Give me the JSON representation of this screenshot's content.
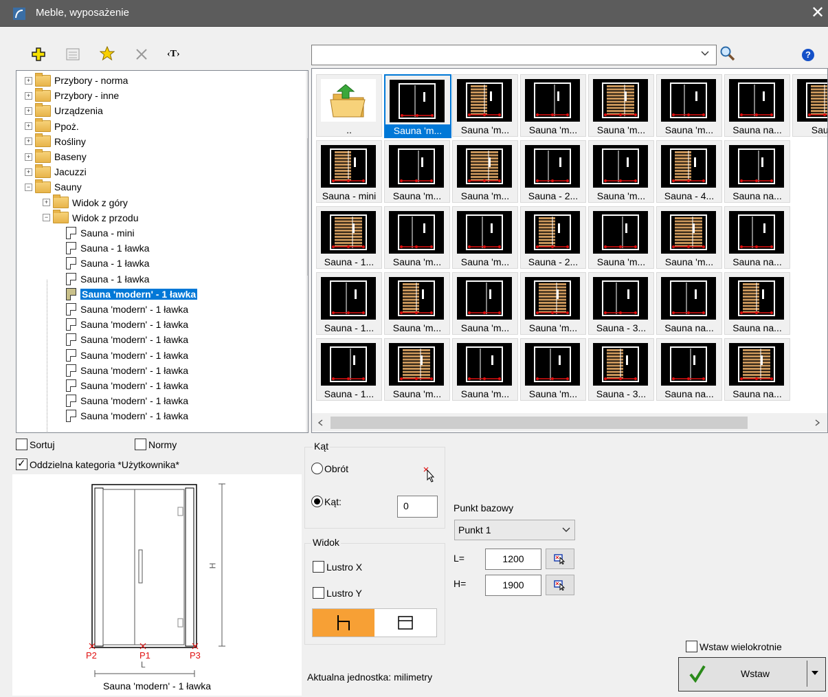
{
  "window": {
    "title": "Meble, wyposażenie",
    "close": "✕"
  },
  "toolbar": {
    "text_tool": "‹T›",
    "search_value": "",
    "help": "?"
  },
  "tree": {
    "items": [
      {
        "label": "Przybory - norma",
        "type": "folder"
      },
      {
        "label": "Przybory - inne",
        "type": "folder"
      },
      {
        "label": "Urządzenia",
        "type": "folder"
      },
      {
        "label": "Ppoż.",
        "type": "folder"
      },
      {
        "label": "Rośliny",
        "type": "folder"
      },
      {
        "label": "Baseny",
        "type": "folder"
      },
      {
        "label": "Jacuzzi",
        "type": "folder"
      },
      {
        "label": "Sauny",
        "type": "folder"
      },
      {
        "label": "Widok z góry",
        "type": "folder"
      },
      {
        "label": "Widok z przodu",
        "type": "folder"
      },
      {
        "label": "Sauna - mini",
        "type": "doc"
      },
      {
        "label": "Sauna - 1 ławka",
        "type": "doc"
      },
      {
        "label": "Sauna - 1 ławka",
        "type": "doc"
      },
      {
        "label": "Sauna - 1 ławka",
        "type": "doc"
      },
      {
        "label": "Sauna 'modern' - 1 ławka",
        "type": "doc",
        "selected": true
      },
      {
        "label": "Sauna 'modern' - 1 ławka",
        "type": "doc"
      },
      {
        "label": "Sauna 'modern' - 1 ławka",
        "type": "doc"
      },
      {
        "label": "Sauna 'modern' - 1 ławka",
        "type": "doc"
      },
      {
        "label": "Sauna 'modern' - 1 ławka",
        "type": "doc"
      },
      {
        "label": "Sauna 'modern' - 1 ławka",
        "type": "doc"
      },
      {
        "label": "Sauna 'modern' - 1 ławka",
        "type": "doc"
      },
      {
        "label": "Sauna 'modern' - 1 ławka",
        "type": "doc"
      },
      {
        "label": "Sauna 'modern' - 1 ławka",
        "type": "doc"
      }
    ]
  },
  "gallery": {
    "rows": [
      [
        "..",
        "Sauna 'm...",
        "Sauna 'm...",
        "Sauna 'm...",
        "Sauna 'm...",
        "Sauna 'm...",
        "Sauna na...",
        "Sauna"
      ],
      [
        "Sauna - mini",
        "Sauna 'm...",
        "Sauna 'm...",
        "Sauna - 2...",
        "Sauna 'm...",
        "Sauna - 4...",
        "Sauna na..."
      ],
      [
        "Sauna - 1...",
        "Sauna 'm...",
        "Sauna 'm...",
        "Sauna - 2...",
        "Sauna 'm...",
        "Sauna 'm...",
        "Sauna na..."
      ],
      [
        "Sauna - 1...",
        "Sauna 'm...",
        "Sauna 'm...",
        "Sauna 'm...",
        "Sauna - 3...",
        "Sauna na...",
        "Sauna na..."
      ],
      [
        "Sauna - 1...",
        "Sauna 'm...",
        "Sauna 'm...",
        "Sauna 'm...",
        "Sauna - 3...",
        "Sauna na...",
        "Sauna na..."
      ]
    ],
    "selected_row": 0,
    "selected_col": 1
  },
  "options": {
    "sortuj": "Sortuj",
    "normy": "Normy",
    "oddzielna": "Oddzielna kategoria *Użytkownika*"
  },
  "preview": {
    "caption": "Sauna 'modern' - 1 ławka",
    "p1": "P1",
    "p2": "P2",
    "p3": "P3",
    "l": "L",
    "h": "H"
  },
  "kat": {
    "title": "Kąt",
    "obrot": "Obrót",
    "kat_label": "Kąt:",
    "kat_value": "0"
  },
  "widok": {
    "title": "Widok",
    "lustro_x": "Lustro X",
    "lustro_y": "Lustro Y"
  },
  "punkt": {
    "title": "Punkt bazowy",
    "value": "Punkt 1",
    "l_label": "L=",
    "l_value": "1200",
    "h_label": "H=",
    "h_value": "1900"
  },
  "unit": "Aktualna jednostka: milimetry",
  "insert": {
    "multi": "Wstaw wielokrotnie",
    "button": "Wstaw"
  },
  "colors": {
    "accent": "#0078d7",
    "orange": "#f7a035",
    "titlebar": "#5c5c5c"
  }
}
